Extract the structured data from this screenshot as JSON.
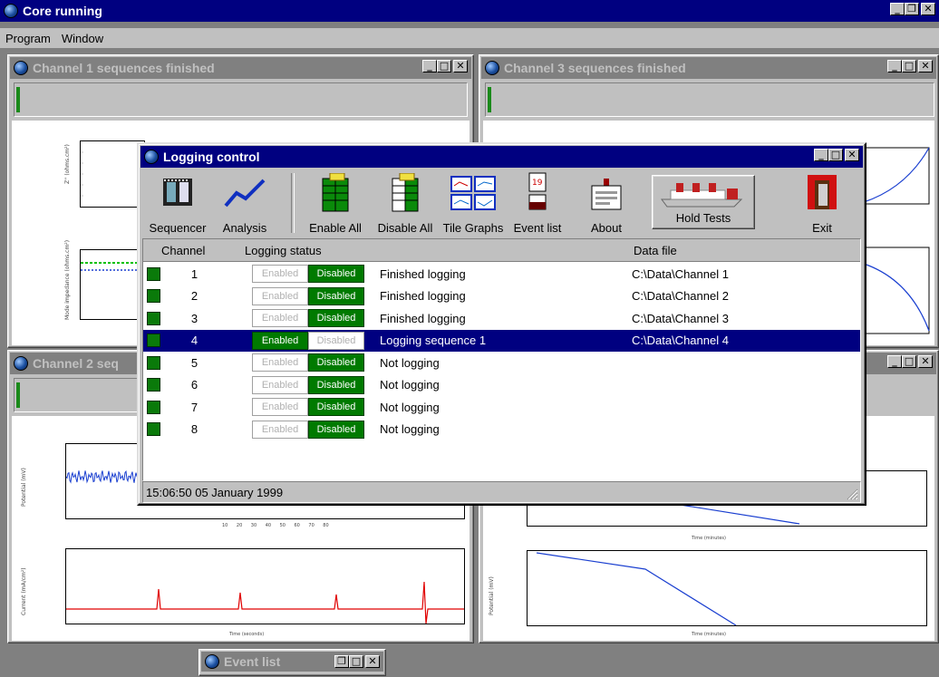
{
  "app": {
    "title": "Core running"
  },
  "menu": [
    "Program",
    "Window"
  ],
  "windows": {
    "ch1": {
      "title": "Channel 1 sequences finished"
    },
    "ch3": {
      "title": "Channel 3 sequences finished"
    },
    "ch2": {
      "title": "Channel 2 seq"
    },
    "event": {
      "title": "Event list"
    }
  },
  "logging": {
    "title": "Logging control",
    "toolbar": {
      "sequencer": "Sequencer",
      "analysis": "Analysis",
      "enable_all": "Enable All",
      "disable_all": "Disable All",
      "tile_graphs": "Tile Graphs",
      "event_list": "Event list",
      "about": "About",
      "hold_tests": "Hold Tests",
      "exit": "Exit"
    },
    "headers": {
      "channel": "Channel",
      "status": "Logging status",
      "file": "Data file"
    },
    "enabled_label": "Enabled",
    "disabled_label": "Disabled",
    "rows": [
      {
        "channel": "1",
        "state": "disabled",
        "status": "Finished logging",
        "file": "C:\\Data\\Channel 1"
      },
      {
        "channel": "2",
        "state": "disabled",
        "status": "Finished logging",
        "file": "C:\\Data\\Channel 2"
      },
      {
        "channel": "3",
        "state": "disabled",
        "status": "Finished logging",
        "file": "C:\\Data\\Channel 3"
      },
      {
        "channel": "4",
        "state": "enabled",
        "status": "Logging sequence 1",
        "file": "C:\\Data\\Channel 4",
        "selected": true
      },
      {
        "channel": "5",
        "state": "disabled",
        "status": "Not logging",
        "file": ""
      },
      {
        "channel": "6",
        "state": "disabled",
        "status": "Not logging",
        "file": ""
      },
      {
        "channel": "7",
        "state": "disabled",
        "status": "Not logging",
        "file": ""
      },
      {
        "channel": "8",
        "state": "disabled",
        "status": "Not logging",
        "file": ""
      }
    ],
    "statusbar": "15:06:50   05 January 1999"
  },
  "plots": {
    "ch2_top_ylabel": "Potential (mV)",
    "ch2_bottom_ylabel": "Current (mA/cm²)",
    "ch2_xlabel": "Time (seconds)",
    "ch3_xlabel": "Time (minutes)",
    "ch3_ylabel": "Potential (mV)",
    "ch1_ylabel_top": "Z'' (ohms.cm²)",
    "ch1_ylabel_bottom": "Mode impedance (ohms.cm²)"
  },
  "colors": {
    "titlebar_active": "#000080",
    "enabled_green": "#007a00",
    "led_green": "#0a7a0a"
  }
}
